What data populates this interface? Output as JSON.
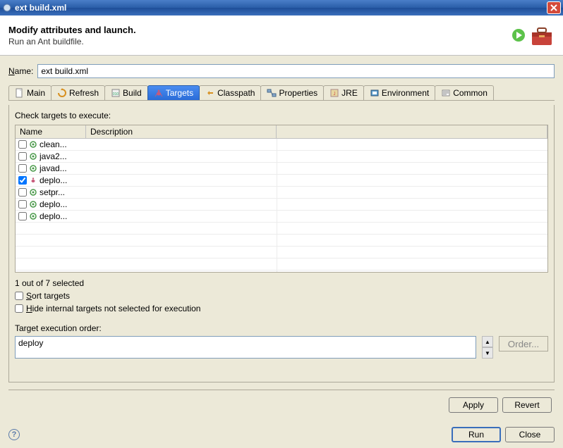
{
  "window": {
    "title": "ext build.xml"
  },
  "header": {
    "title": "Modify attributes and launch.",
    "subtitle": "Run an Ant buildfile."
  },
  "name": {
    "label": "Name:",
    "value": "ext build.xml"
  },
  "tabs": [
    {
      "label": "Main",
      "icon": "file-icon",
      "active": false
    },
    {
      "label": "Refresh",
      "icon": "refresh-icon",
      "active": false
    },
    {
      "label": "Build",
      "icon": "build-icon",
      "active": false
    },
    {
      "label": "Targets",
      "icon": "ant-icon",
      "active": true
    },
    {
      "label": "Classpath",
      "icon": "classpath-icon",
      "active": false
    },
    {
      "label": "Properties",
      "icon": "properties-icon",
      "active": false
    },
    {
      "label": "JRE",
      "icon": "jre-icon",
      "active": false
    },
    {
      "label": "Environment",
      "icon": "env-icon",
      "active": false
    },
    {
      "label": "Common",
      "icon": "common-icon",
      "active": false
    }
  ],
  "targets": {
    "check_label": "Check targets to execute:",
    "columns": {
      "name": "Name",
      "description": "Description"
    },
    "rows": [
      {
        "checked": false,
        "icon": "target-default",
        "name": "clean..."
      },
      {
        "checked": false,
        "icon": "target-default",
        "name": "java2..."
      },
      {
        "checked": false,
        "icon": "target-default",
        "name": "javad..."
      },
      {
        "checked": true,
        "icon": "target-ant",
        "name": "deplo..."
      },
      {
        "checked": false,
        "icon": "target-default",
        "name": "setpr..."
      },
      {
        "checked": false,
        "icon": "target-default",
        "name": "deplo..."
      },
      {
        "checked": false,
        "icon": "target-default",
        "name": "deplo..."
      }
    ],
    "selected_text": "1 out of 7 selected",
    "sort_label": "Sort targets",
    "sort_checked": false,
    "hide_label": "Hide internal targets not selected for execution",
    "hide_checked": false,
    "order_label": "Target execution order:",
    "order_value": "deploy",
    "order_button": "Order..."
  },
  "buttons": {
    "apply": "Apply",
    "revert": "Revert",
    "run": "Run",
    "close": "Close"
  }
}
